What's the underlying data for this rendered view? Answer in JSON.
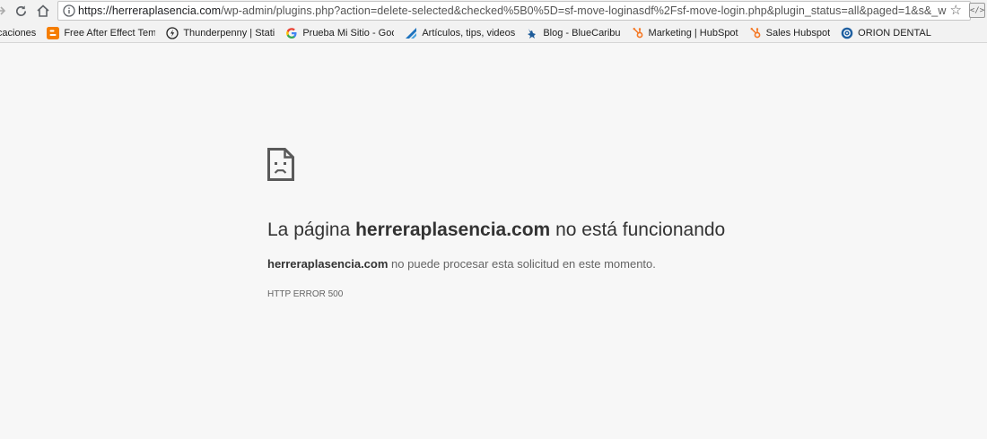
{
  "browser": {
    "url_host": "https://herreraplasencia.com",
    "url_path": "/wp-admin/plugins.php?action=delete-selected&checked%5B0%5D=sf-move-loginasdf%2Fsf-move-login.php&plugin_status=all&paged=1&s&_w",
    "ext_label": "</>"
  },
  "bookmarks": [
    {
      "label": "licaciones",
      "icon": "apps-icon"
    },
    {
      "label": "Free After Effect Temp",
      "icon": "blogger-icon",
      "color": "#f57d00"
    },
    {
      "label": "Thunderpenny | Static",
      "icon": "thunderpenny-icon"
    },
    {
      "label": "Prueba Mi Sitio - Goo",
      "icon": "google-icon"
    },
    {
      "label": "Artículos, tips, videos",
      "icon": "stripes-icon",
      "color": "#1e73be"
    },
    {
      "label": "Blog - BlueCaribu",
      "icon": "bluecaribu-icon",
      "color": "#1e5c9a"
    },
    {
      "label": "Marketing | HubSpot",
      "icon": "hubspot-icon",
      "color": "#f57722"
    },
    {
      "label": "Sales Hubspot",
      "icon": "hubspot-icon",
      "color": "#f57722"
    },
    {
      "label": "ORION DENTAL",
      "icon": "orion-icon",
      "color": "#1f5fa0"
    }
  ],
  "error": {
    "title_prefix": "La página",
    "title_host": "herreraplasencia.com",
    "title_suffix": "no está funcionando",
    "desc_host": "herreraplasencia.com",
    "desc_text": "no puede procesar esta solicitud en este momento.",
    "code": "HTTP ERROR 500"
  }
}
